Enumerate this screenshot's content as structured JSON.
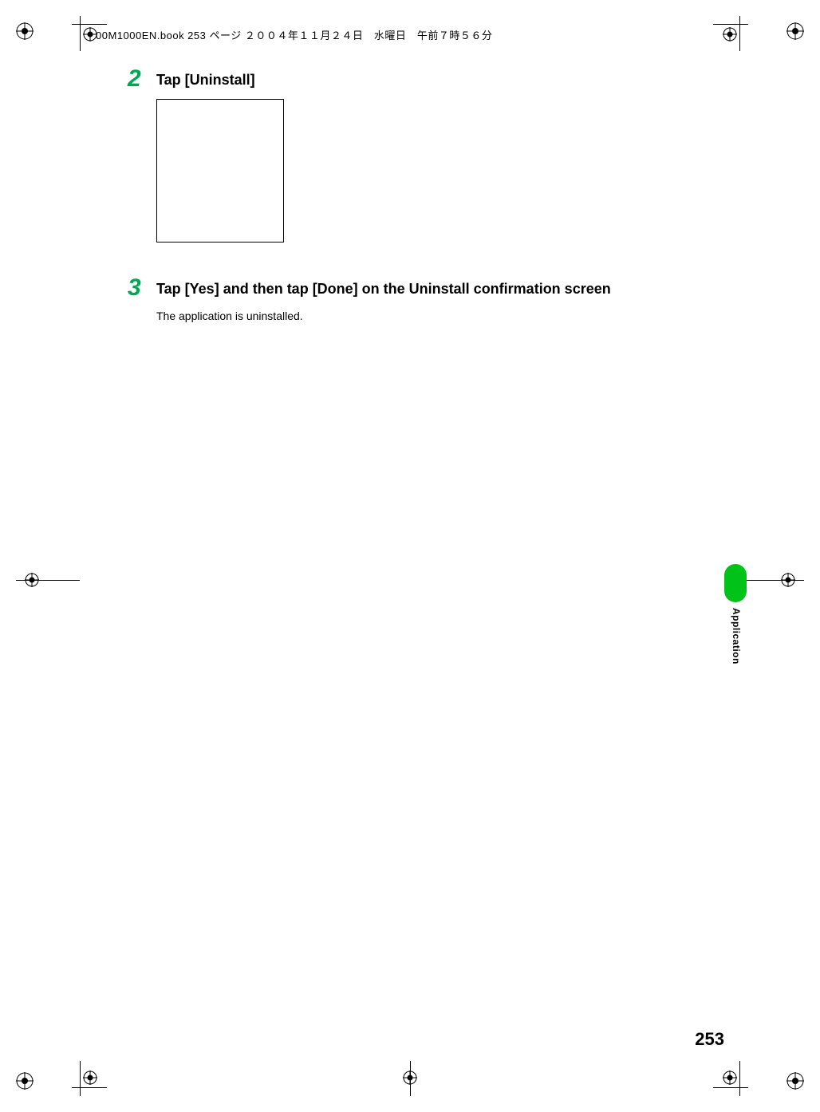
{
  "header": {
    "slug": "00M1000EN.book  253 ページ  ２００４年１１月２４日　水曜日　午前７時５６分"
  },
  "steps": [
    {
      "number": "2",
      "title": "Tap [Uninstall]",
      "body": "",
      "has_image": true
    },
    {
      "number": "3",
      "title": "Tap [Yes] and then tap [Done] on the Uninstall confirmation screen",
      "body": "The application is uninstalled.",
      "has_image": false
    }
  ],
  "side_tab": {
    "label": "Application"
  },
  "page_number": "253"
}
